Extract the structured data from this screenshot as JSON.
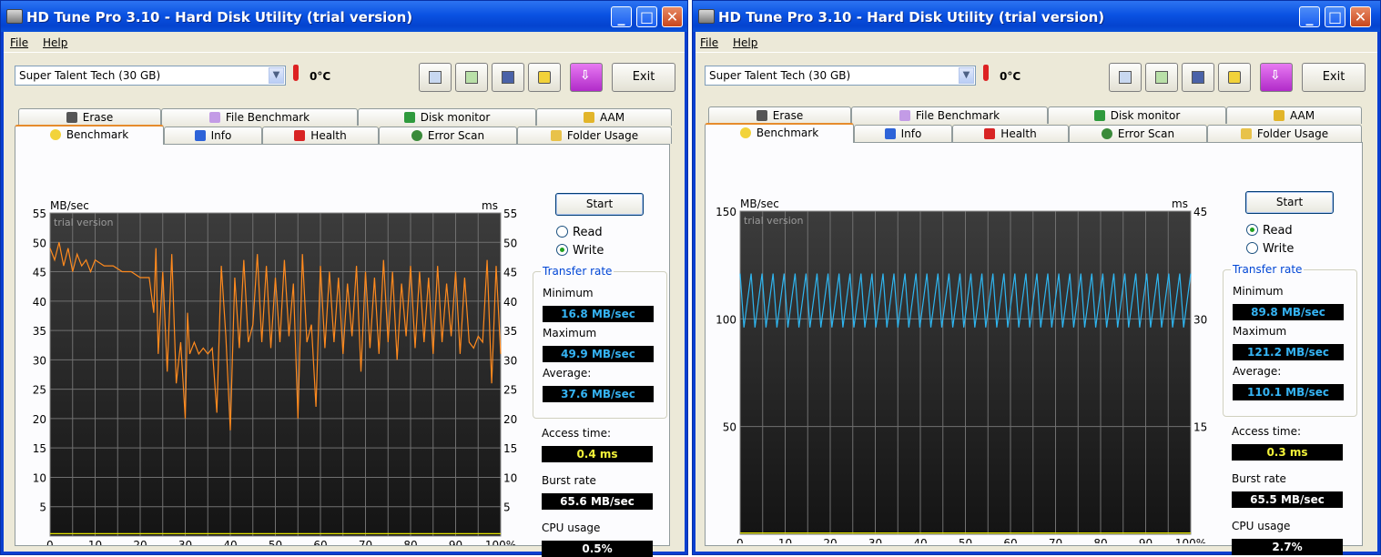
{
  "windows": [
    {
      "title": "HD Tune Pro 3.10 - Hard Disk Utility (trial version)",
      "menu": [
        "File",
        "Help"
      ],
      "drive": "Super Talent Tech (30 GB)",
      "temperature": "0°C",
      "exit_label": "Exit",
      "tabs_top": [
        "Erase",
        "File Benchmark",
        "Disk monitor",
        "AAM"
      ],
      "tabs_bottom": [
        "Benchmark",
        "Info",
        "Health",
        "Error Scan",
        "Folder Usage"
      ],
      "start_label": "Start",
      "mode_read": "Read",
      "mode_write": "Write",
      "selected_mode": "Write",
      "transfer_rate_title": "Transfer rate",
      "minimum_label": "Minimum",
      "minimum_value": "16.8 MB/sec",
      "maximum_label": "Maximum",
      "maximum_value": "49.9 MB/sec",
      "average_label": "Average:",
      "average_value": "37.6 MB/sec",
      "access_time_label": "Access time:",
      "access_time_value": "0.4 ms",
      "burst_rate_label": "Burst rate",
      "burst_rate_value": "65.6 MB/sec",
      "cpu_usage_label": "CPU usage",
      "cpu_usage_value": "0.5%",
      "chart_data": {
        "type": "line",
        "left_unit": "MB/sec",
        "right_unit": "ms",
        "watermark": "trial version",
        "ylim": [
          0,
          55
        ],
        "y2lim": [
          0,
          55
        ],
        "yticks": [
          5,
          10,
          15,
          20,
          25,
          30,
          35,
          40,
          45,
          50,
          55
        ],
        "y2ticks": [
          5,
          10,
          15,
          20,
          25,
          30,
          35,
          40,
          45,
          50,
          55
        ],
        "xticks": [
          "0",
          "10",
          "20",
          "30",
          "40",
          "50",
          "60",
          "70",
          "80",
          "90",
          "100%"
        ],
        "series": [
          {
            "color": "#ff8a1e",
            "x": [
              0,
              1,
              2,
              3,
              4,
              5,
              6,
              7,
              8,
              9,
              10,
              12,
              14,
              16,
              18,
              20,
              22,
              23,
              23.5,
              24,
              25,
              26,
              27,
              28,
              29,
              30,
              30.5,
              31,
              32,
              33,
              34,
              35,
              36,
              37,
              38,
              39,
              40,
              41,
              42,
              43,
              44,
              45,
              46,
              47,
              48,
              49,
              50,
              51,
              52,
              53,
              54,
              55,
              56,
              57,
              58,
              59,
              60,
              61,
              62,
              63,
              64,
              65,
              66,
              67,
              68,
              69,
              70,
              71,
              72,
              73,
              74,
              75,
              76,
              77,
              78,
              79,
              80,
              81,
              82,
              83,
              84,
              85,
              86,
              87,
              88,
              89,
              90,
              91,
              92,
              93,
              94,
              95,
              96,
              97,
              98,
              99,
              100
            ],
            "values": [
              49,
              47,
              50,
              46,
              49,
              45,
              48,
              46,
              47,
              45,
              47,
              46,
              46,
              45,
              45,
              44,
              44,
              38,
              49,
              31,
              45,
              28,
              48,
              26,
              33,
              20,
              38,
              31,
              33,
              31,
              32,
              31,
              32,
              21,
              46,
              34,
              18,
              44,
              32,
              47,
              33,
              36,
              48,
              33,
              46,
              32,
              44,
              33,
              47,
              34,
              43,
              20,
              48,
              33,
              36,
              22,
              46,
              32,
              45,
              33,
              44,
              31,
              43,
              34,
              46,
              28,
              45,
              32,
              44,
              31,
              47,
              33,
              45,
              30,
              43,
              34,
              46,
              32,
              45,
              33,
              44,
              31,
              46,
              33,
              43,
              34,
              45,
              31,
              44,
              33,
              32,
              34,
              33,
              47,
              26,
              46,
              31
            ]
          },
          {
            "color": "#e6e600",
            "x": [
              0,
              100
            ],
            "values": [
              0.4,
              0.4
            ]
          }
        ]
      }
    },
    {
      "title": "HD Tune Pro 3.10 - Hard Disk Utility (trial version)",
      "menu": [
        "File",
        "Help"
      ],
      "drive": "Super Talent Tech (30 GB)",
      "temperature": "0°C",
      "exit_label": "Exit",
      "tabs_top": [
        "Erase",
        "File Benchmark",
        "Disk monitor",
        "AAM"
      ],
      "tabs_bottom": [
        "Benchmark",
        "Info",
        "Health",
        "Error Scan",
        "Folder Usage"
      ],
      "start_label": "Start",
      "mode_read": "Read",
      "mode_write": "Write",
      "selected_mode": "Read",
      "transfer_rate_title": "Transfer rate",
      "minimum_label": "Minimum",
      "minimum_value": "89.8 MB/sec",
      "maximum_label": "Maximum",
      "maximum_value": "121.2 MB/sec",
      "average_label": "Average:",
      "average_value": "110.1 MB/sec",
      "access_time_label": "Access time:",
      "access_time_value": "0.3 ms",
      "burst_rate_label": "Burst rate",
      "burst_rate_value": "65.5 MB/sec",
      "cpu_usage_label": "CPU usage",
      "cpu_usage_value": "2.7%",
      "chart_data": {
        "type": "line",
        "left_unit": "MB/sec",
        "right_unit": "ms",
        "watermark": "trial version",
        "ylim": [
          0,
          150
        ],
        "y2lim": [
          0,
          45
        ],
        "yticks": [
          50,
          100,
          150
        ],
        "y2ticks": [
          15,
          30,
          45
        ],
        "xticks": [
          "0",
          "10",
          "20",
          "30",
          "40",
          "50",
          "60",
          "70",
          "80",
          "90",
          "100%"
        ],
        "series": [
          {
            "color": "#2fb6f0",
            "pattern": "sawtooth",
            "cycles": 41,
            "high": 121,
            "low": 96,
            "start": 0,
            "end": 100
          },
          {
            "color": "#e6e600",
            "x": [
              0,
              100
            ],
            "values": [
              0.6,
              0.6
            ]
          }
        ]
      }
    }
  ]
}
